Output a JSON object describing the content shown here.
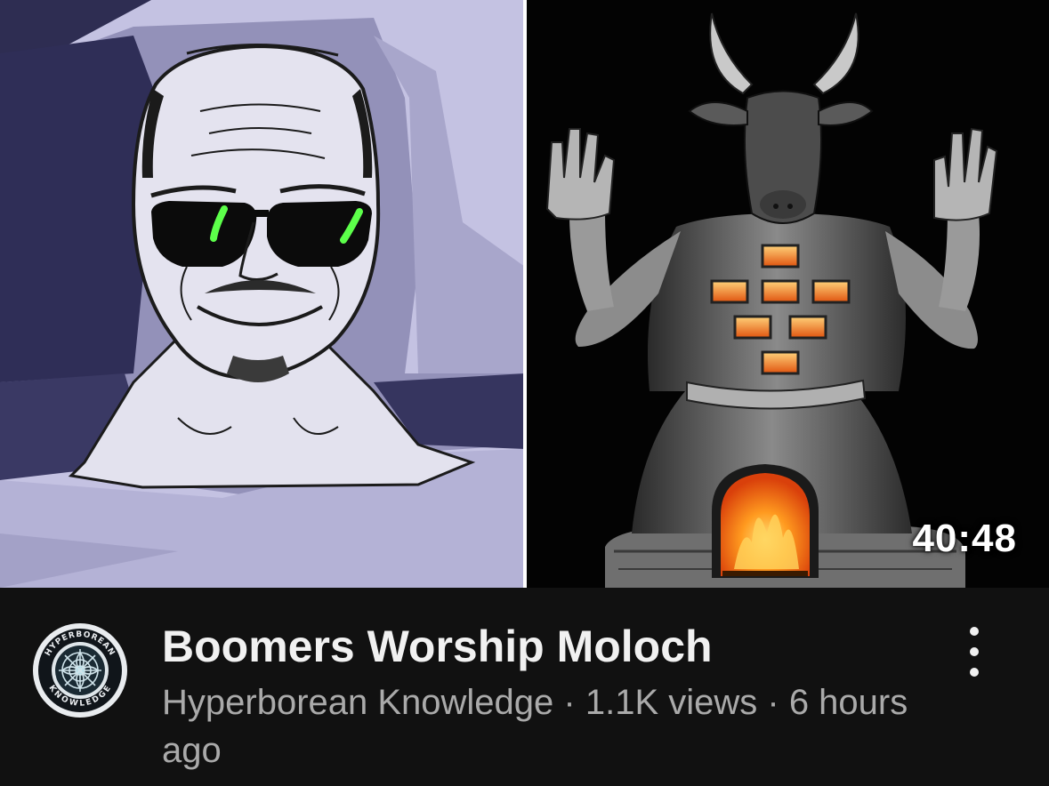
{
  "video": {
    "duration": "40:48",
    "title": "Boomers Worship Moloch",
    "channel_name": "Hyperborean Knowledge",
    "separator_1": " · ",
    "views": "1.1K views",
    "separator_2": " · ",
    "age": "6 hours ago"
  },
  "avatar": {
    "ring_text_top": "HYPERBOREAN",
    "ring_text_bottom": "KNOWLEDGE"
  },
  "icons": {
    "more": "vertical-ellipsis-icon"
  },
  "colors": {
    "background": "#0f0f0f",
    "title_text": "#f1f1f1",
    "meta_text": "#aaaaaa",
    "lavender": "#c8c6e6",
    "fire": "#ff7a18"
  }
}
